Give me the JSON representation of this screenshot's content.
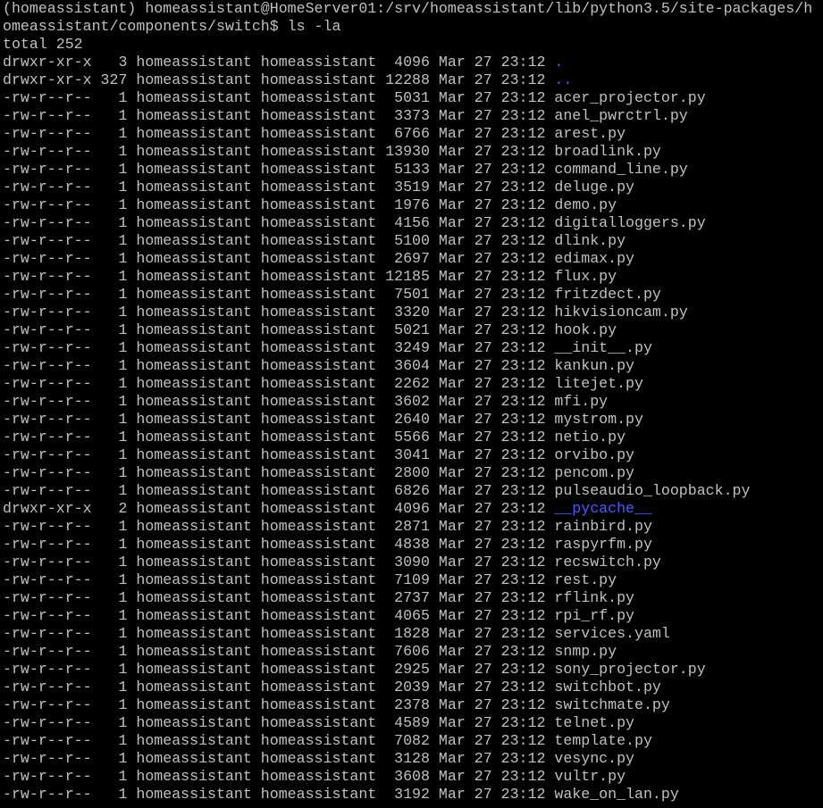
{
  "terminal": {
    "colors": {
      "background": "#000000",
      "foreground": "#c0c0c0",
      "directory": "#4a5cff"
    },
    "prompt_line_1": "(homeassistant) homeassistant@HomeServer01:/srv/homeassistant/lib/python3.5/site-packages/h",
    "prompt_line_2": "omeassistant/components/switch$ ls -la",
    "total": "total 252",
    "entries": [
      {
        "meta": "drwxr-xr-x   3 homeassistant homeassistant  4096 Mar 27 23:12 ",
        "name": ".",
        "dir": true
      },
      {
        "meta": "drwxr-xr-x 327 homeassistant homeassistant 12288 Mar 27 23:12 ",
        "name": "..",
        "dir": true
      },
      {
        "meta": "-rw-r--r--   1 homeassistant homeassistant  5031 Mar 27 23:12 ",
        "name": "acer_projector.py",
        "dir": false
      },
      {
        "meta": "-rw-r--r--   1 homeassistant homeassistant  3373 Mar 27 23:12 ",
        "name": "anel_pwrctrl.py",
        "dir": false
      },
      {
        "meta": "-rw-r--r--   1 homeassistant homeassistant  6766 Mar 27 23:12 ",
        "name": "arest.py",
        "dir": false
      },
      {
        "meta": "-rw-r--r--   1 homeassistant homeassistant 13930 Mar 27 23:12 ",
        "name": "broadlink.py",
        "dir": false
      },
      {
        "meta": "-rw-r--r--   1 homeassistant homeassistant  5133 Mar 27 23:12 ",
        "name": "command_line.py",
        "dir": false
      },
      {
        "meta": "-rw-r--r--   1 homeassistant homeassistant  3519 Mar 27 23:12 ",
        "name": "deluge.py",
        "dir": false
      },
      {
        "meta": "-rw-r--r--   1 homeassistant homeassistant  1976 Mar 27 23:12 ",
        "name": "demo.py",
        "dir": false
      },
      {
        "meta": "-rw-r--r--   1 homeassistant homeassistant  4156 Mar 27 23:12 ",
        "name": "digitalloggers.py",
        "dir": false
      },
      {
        "meta": "-rw-r--r--   1 homeassistant homeassistant  5100 Mar 27 23:12 ",
        "name": "dlink.py",
        "dir": false
      },
      {
        "meta": "-rw-r--r--   1 homeassistant homeassistant  2697 Mar 27 23:12 ",
        "name": "edimax.py",
        "dir": false
      },
      {
        "meta": "-rw-r--r--   1 homeassistant homeassistant 12185 Mar 27 23:12 ",
        "name": "flux.py",
        "dir": false
      },
      {
        "meta": "-rw-r--r--   1 homeassistant homeassistant  7501 Mar 27 23:12 ",
        "name": "fritzdect.py",
        "dir": false
      },
      {
        "meta": "-rw-r--r--   1 homeassistant homeassistant  3320 Mar 27 23:12 ",
        "name": "hikvisioncam.py",
        "dir": false
      },
      {
        "meta": "-rw-r--r--   1 homeassistant homeassistant  5021 Mar 27 23:12 ",
        "name": "hook.py",
        "dir": false
      },
      {
        "meta": "-rw-r--r--   1 homeassistant homeassistant  3249 Mar 27 23:12 ",
        "name": "__init__.py",
        "dir": false
      },
      {
        "meta": "-rw-r--r--   1 homeassistant homeassistant  3604 Mar 27 23:12 ",
        "name": "kankun.py",
        "dir": false
      },
      {
        "meta": "-rw-r--r--   1 homeassistant homeassistant  2262 Mar 27 23:12 ",
        "name": "litejet.py",
        "dir": false
      },
      {
        "meta": "-rw-r--r--   1 homeassistant homeassistant  3602 Mar 27 23:12 ",
        "name": "mfi.py",
        "dir": false
      },
      {
        "meta": "-rw-r--r--   1 homeassistant homeassistant  2640 Mar 27 23:12 ",
        "name": "mystrom.py",
        "dir": false
      },
      {
        "meta": "-rw-r--r--   1 homeassistant homeassistant  5566 Mar 27 23:12 ",
        "name": "netio.py",
        "dir": false
      },
      {
        "meta": "-rw-r--r--   1 homeassistant homeassistant  3041 Mar 27 23:12 ",
        "name": "orvibo.py",
        "dir": false
      },
      {
        "meta": "-rw-r--r--   1 homeassistant homeassistant  2800 Mar 27 23:12 ",
        "name": "pencom.py",
        "dir": false
      },
      {
        "meta": "-rw-r--r--   1 homeassistant homeassistant  6826 Mar 27 23:12 ",
        "name": "pulseaudio_loopback.py",
        "dir": false
      },
      {
        "meta": "drwxr-xr-x   2 homeassistant homeassistant  4096 Mar 27 23:12 ",
        "name": "__pycache__",
        "dir": true
      },
      {
        "meta": "-rw-r--r--   1 homeassistant homeassistant  2871 Mar 27 23:12 ",
        "name": "rainbird.py",
        "dir": false
      },
      {
        "meta": "-rw-r--r--   1 homeassistant homeassistant  4838 Mar 27 23:12 ",
        "name": "raspyrfm.py",
        "dir": false
      },
      {
        "meta": "-rw-r--r--   1 homeassistant homeassistant  3090 Mar 27 23:12 ",
        "name": "recswitch.py",
        "dir": false
      },
      {
        "meta": "-rw-r--r--   1 homeassistant homeassistant  7109 Mar 27 23:12 ",
        "name": "rest.py",
        "dir": false
      },
      {
        "meta": "-rw-r--r--   1 homeassistant homeassistant  2737 Mar 27 23:12 ",
        "name": "rflink.py",
        "dir": false
      },
      {
        "meta": "-rw-r--r--   1 homeassistant homeassistant  4065 Mar 27 23:12 ",
        "name": "rpi_rf.py",
        "dir": false
      },
      {
        "meta": "-rw-r--r--   1 homeassistant homeassistant  1828 Mar 27 23:12 ",
        "name": "services.yaml",
        "dir": false
      },
      {
        "meta": "-rw-r--r--   1 homeassistant homeassistant  7606 Mar 27 23:12 ",
        "name": "snmp.py",
        "dir": false
      },
      {
        "meta": "-rw-r--r--   1 homeassistant homeassistant  2925 Mar 27 23:12 ",
        "name": "sony_projector.py",
        "dir": false
      },
      {
        "meta": "-rw-r--r--   1 homeassistant homeassistant  2039 Mar 27 23:12 ",
        "name": "switchbot.py",
        "dir": false
      },
      {
        "meta": "-rw-r--r--   1 homeassistant homeassistant  2378 Mar 27 23:12 ",
        "name": "switchmate.py",
        "dir": false
      },
      {
        "meta": "-rw-r--r--   1 homeassistant homeassistant  4589 Mar 27 23:12 ",
        "name": "telnet.py",
        "dir": false
      },
      {
        "meta": "-rw-r--r--   1 homeassistant homeassistant  7082 Mar 27 23:12 ",
        "name": "template.py",
        "dir": false
      },
      {
        "meta": "-rw-r--r--   1 homeassistant homeassistant  3128 Mar 27 23:12 ",
        "name": "vesync.py",
        "dir": false
      },
      {
        "meta": "-rw-r--r--   1 homeassistant homeassistant  3608 Mar 27 23:12 ",
        "name": "vultr.py",
        "dir": false
      },
      {
        "meta": "-rw-r--r--   1 homeassistant homeassistant  3192 Mar 27 23:12 ",
        "name": "wake_on_lan.py",
        "dir": false
      }
    ]
  }
}
